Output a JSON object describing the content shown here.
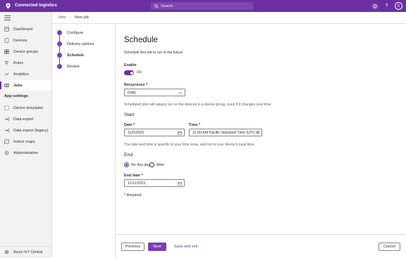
{
  "app": {
    "title": "Connected logistics"
  },
  "search": {
    "placeholder": "Search"
  },
  "sidebar": {
    "items": [
      {
        "label": "Dashboard",
        "icon": "dashboard-icon"
      },
      {
        "label": "Devices",
        "icon": "devices-icon"
      },
      {
        "label": "Device groups",
        "icon": "device-groups-icon"
      },
      {
        "label": "Rules",
        "icon": "rules-icon"
      },
      {
        "label": "Analytics",
        "icon": "analytics-icon"
      },
      {
        "label": "Jobs",
        "icon": "jobs-icon",
        "active": true
      }
    ],
    "section_label": "App settings",
    "settings_items": [
      {
        "label": "Device templates",
        "icon": "device-templates-icon"
      },
      {
        "label": "Data export",
        "icon": "data-export-icon"
      },
      {
        "label": "Data export (legacy)",
        "icon": "data-export-legacy-icon"
      },
      {
        "label": "Indoor maps",
        "icon": "indoor-maps-icon"
      },
      {
        "label": "Administration",
        "icon": "administration-icon"
      }
    ],
    "footer_label": "Azure IoT Central"
  },
  "breadcrumb": {
    "parent": "Jobs",
    "current": "New job"
  },
  "steps": [
    {
      "label": "Configure"
    },
    {
      "label": "Delivery options"
    },
    {
      "label": "Schedule",
      "current": true
    },
    {
      "label": "Review"
    }
  ],
  "main": {
    "title": "Schedule",
    "description": "Schedule this job to run in the future.",
    "enable_label": "Enable",
    "enable_state": "On",
    "recurrence_label": "Recurrence *",
    "recurrence_value": "Daily",
    "recurrence_note": "Scheduled jobs will always run on the devices in a device group, even if it changes over time.",
    "start_heading": "Start",
    "date_label": "Date *",
    "date_value": "11/5/2020",
    "time_label": "Time *",
    "time_value": "11:00 AM Pacific Standard Time (UTC-8)",
    "time_note": "The date and time is specific to your time zone, and not to your device's local time.",
    "end_heading": "End",
    "end_option_on": "On this day",
    "end_option_after": "After",
    "end_date_label": "End date *",
    "end_date_value": "11/11/2021",
    "required_note": "* Required"
  },
  "footer": {
    "previous": "Previous",
    "next": "Next",
    "save_exit": "Save and exit",
    "cancel": "Cancel"
  },
  "colors": {
    "accent": "#6b2fa1",
    "step": "#7b3fb5"
  }
}
